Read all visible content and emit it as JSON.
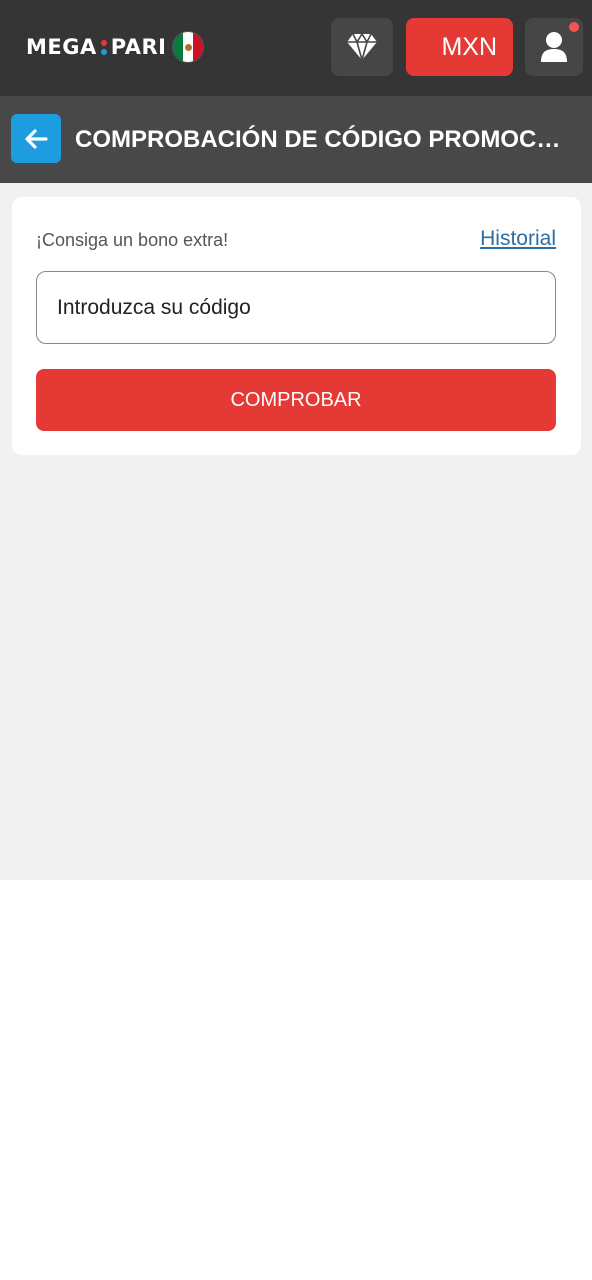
{
  "header": {
    "logo": {
      "left": "MEGA",
      "right": "PARI",
      "dot_colors": [
        "#e53935",
        "#1d9ce0"
      ]
    },
    "flag": {
      "colors": [
        "#0b7a3e",
        "#ffffff",
        "#ce1126"
      ]
    },
    "diamond_icon": "diamond-icon",
    "currency": "MXN",
    "profile_icon": "user-icon"
  },
  "subheader": {
    "back_icon": "arrow-left-icon",
    "title": "COMPROBACIÓN DE CÓDIGO PROMOCI…"
  },
  "promo": {
    "note": "¡Consiga un bono extra!",
    "history_link": "Historial",
    "input_placeholder": "Introduzca su código",
    "submit_label": "COMPROBAR"
  },
  "colors": {
    "accent": "#e53935",
    "back_button": "#1d9ce0",
    "topbar": "#353535",
    "subbar": "#484848",
    "link": "#2e6da4"
  }
}
